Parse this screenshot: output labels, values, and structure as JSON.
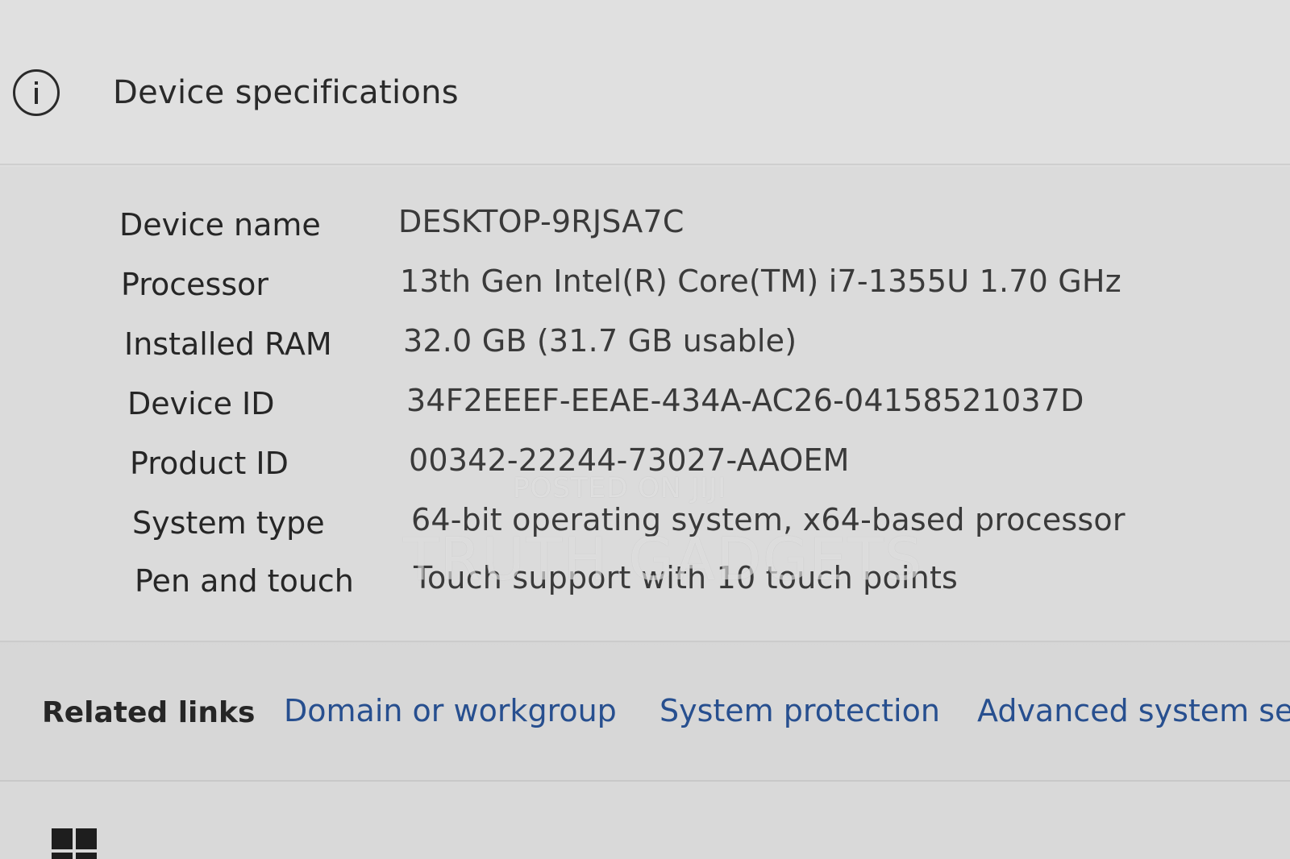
{
  "header": {
    "icon": "info-icon",
    "title": "Device specifications"
  },
  "specs": [
    {
      "label": "Device name",
      "value": "DESKTOP-9RJSA7C"
    },
    {
      "label": "Processor",
      "value": "13th Gen Intel(R) Core(TM) i7-1355U   1.70 GHz"
    },
    {
      "label": "Installed RAM",
      "value": "32.0 GB (31.7 GB usable)"
    },
    {
      "label": "Device ID",
      "value": "34F2EEEF-EEAE-434A-AC26-04158521037D"
    },
    {
      "label": "Product ID",
      "value": "00342-22244-73027-AAOEM"
    },
    {
      "label": "System type",
      "value": "64-bit operating system, x64-based processor"
    },
    {
      "label": "Pen and touch",
      "value": "Touch support with 10 touch points"
    }
  ],
  "related": {
    "label": "Related links",
    "links": [
      "Domain or workgroup",
      "System protection",
      "Advanced system se"
    ]
  },
  "watermark": {
    "line1": "POSTED ON JIJI",
    "line2": "TRUTH GADGETS"
  },
  "colors": {
    "link": "#274f8f",
    "text": "#2a2a2a"
  }
}
